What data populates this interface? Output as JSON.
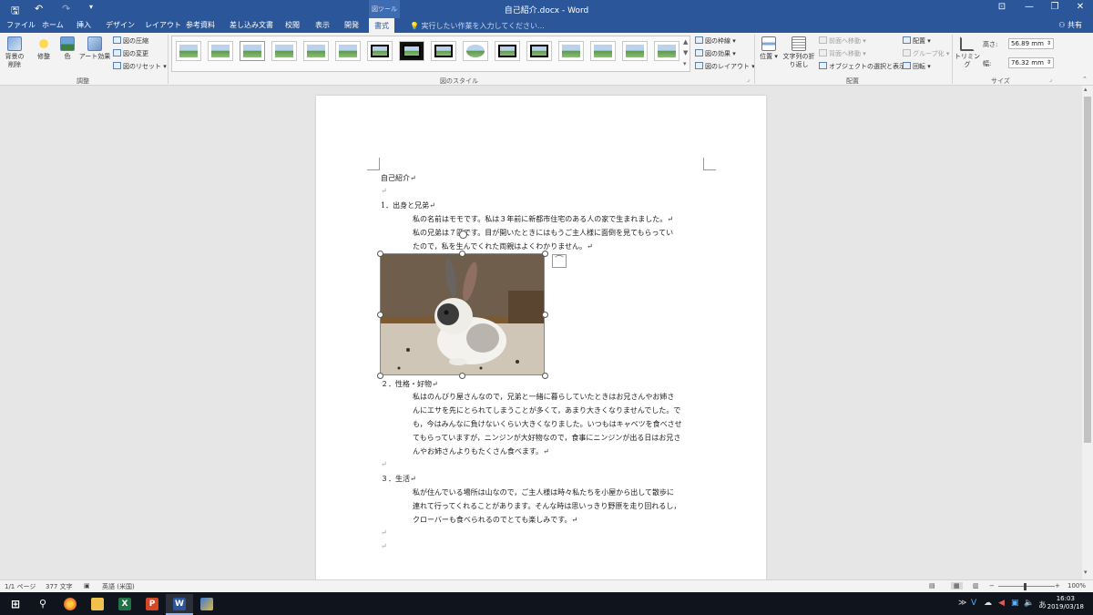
{
  "titlebar": {
    "doc_title": "自己紹介.docx - Word",
    "context_tool": "図ツール",
    "qat": {
      "save": "🖫",
      "undo": "↶",
      "redo": "↷",
      "more": "▾"
    },
    "win": {
      "options": "⊡",
      "minimize": "—",
      "restore": "❐",
      "close": "✕"
    }
  },
  "tabs": [
    {
      "label": "ファイル"
    },
    {
      "label": "ホーム"
    },
    {
      "label": "挿入"
    },
    {
      "label": "デザイン"
    },
    {
      "label": "レイアウト"
    },
    {
      "label": "参考資料"
    },
    {
      "label": "差し込み文書"
    },
    {
      "label": "校閲"
    },
    {
      "label": "表示"
    },
    {
      "label": "開発"
    },
    {
      "label": "書式"
    }
  ],
  "tellme": "💡 実行したい作業を入力してください...",
  "share": "共有",
  "ribbon": {
    "adjust": {
      "remove_bg": "背景の削除",
      "corrections": "修整",
      "color": "色",
      "artistic": "アート効果",
      "compress": "図の圧縮",
      "change": "図の変更",
      "reset": "図のリセット",
      "group_label": "調整"
    },
    "styles": {
      "border": "図の枠線",
      "effects": "図の効果",
      "layout": "図のレイアウト",
      "group_label": "図のスタイル"
    },
    "arrange": {
      "position": "位置",
      "wrap": "文字列の折り返し",
      "bring_forward": "前面へ移動",
      "send_backward": "背面へ移動",
      "selection_pane": "オブジェクトの選択と表示",
      "align": "配置",
      "group": "グループ化",
      "rotate": "回転",
      "group_label": "配置"
    },
    "size": {
      "crop": "トリミング",
      "height_label": "高さ:",
      "height": "56.89 mm",
      "width_label": "幅:",
      "width": "76.32 mm",
      "group_label": "サイズ"
    }
  },
  "document": {
    "title": "自己紹介↵",
    "empty": "↵",
    "s1_heading": "1．出身と兄弟↵",
    "s1_lines": [
      "私の名前はモモです。私は３年前に新都市住宅のある人の家で生まれました。↵",
      "私の兄弟は７匹です。目が開いたときにはもうご主人様に面倒を見てもらってい",
      "たので，私を生んでくれた両親はよくわかりません。↵"
    ],
    "s2_heading": "２．性格・好物↵",
    "s2_lines": [
      "私はのんびり屋さんなので，兄弟と一緒に暮らしていたときはお兄さんやお姉さ",
      "んにエサを先にとられてしまうことが多くて，あまり大きくなりませんでした。で",
      "も，今はみんなに負けないくらい大きくなりました。いつもはキャベツを食べさせ",
      "てもらっていますが，ニンジンが大好物なので，食事にニンジンが出る日はお兄さ",
      "んやお姉さんよりもたくさん食べます。↵"
    ],
    "s3_heading": "３．生活↵",
    "s3_lines": [
      "私が住んでいる場所は山なので，ご主人様は時々私たちを小屋から出して散歩に",
      "連れて行ってくれることがあります。そんな時は思いっきり野原を走り回れるし，",
      "クローバーも食べられるのでとても楽しみです。↵"
    ]
  },
  "status": {
    "page": "1/1 ページ",
    "words": "377 文字",
    "lang": "英語 (米国)",
    "zoom": "100%"
  },
  "taskbar": {
    "clock_time": "16:03",
    "clock_date": "2019/03/18",
    "ime": "あ"
  }
}
